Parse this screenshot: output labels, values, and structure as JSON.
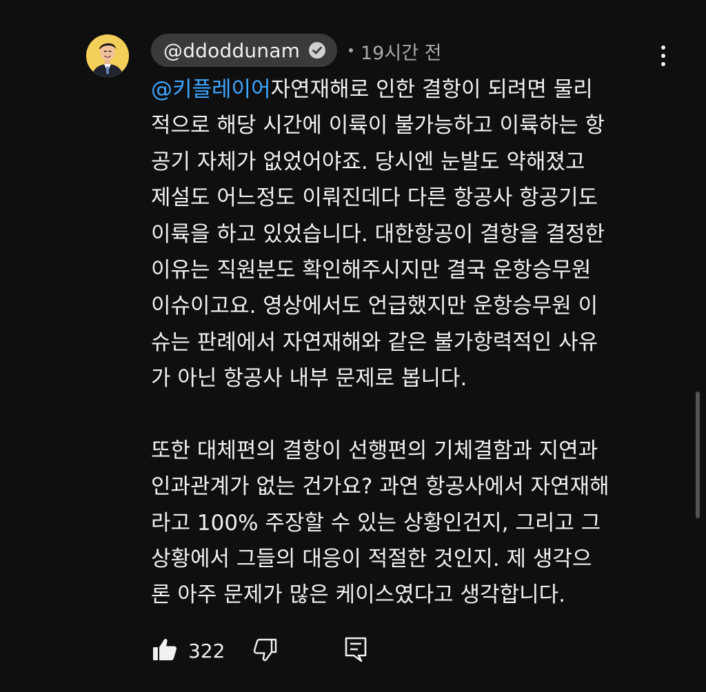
{
  "comment": {
    "author": "@ddoddunam",
    "time": "19시간 전",
    "mention": "@키플레이어",
    "first_line_rest": "자연재해로 인한 결항이 되려면 물리",
    "paragraph1_lines": [
      "적으로 해당 시간에 이륙이 불가능하고 이륙하는 항",
      "공기 자체가 없었어야죠. 당시엔 눈발도 약해졌고",
      "제설도 어느정도 이뤄진데다 다른 항공사 항공기도",
      "이륙을 하고 있었습니다. 대한항공이 결항을 결정한",
      "이유는 직원분도 확인해주시지만 결국 운항승무원",
      "이슈이고요. 영상에서도 언급했지만 운항승무원 이",
      "슈는 판례에서 자연재해와 같은 불가항력적인 사유",
      "가 아닌 항공사 내부 문제로 봅니다."
    ],
    "paragraph2_lines": [
      "또한 대체편의 결항이 선행편의 기체결함과 지연과",
      "인과관계가 없는 건가요? 과연 항공사에서 자연재해",
      "라고 100% 주장할 수 있는 상황인건지, 그리고 그",
      "상황에서 그들의 대응이 적절한 것인지. 제 생각으",
      "론 아주 문제가 많은 케이스였다고 생각합니다."
    ],
    "like_count": "322"
  },
  "icons": {
    "avatar": "avatar-portrait",
    "verified": "checkmark-circle-icon",
    "more": "more-vertical-icon",
    "like": "thumbs-up-icon",
    "dislike": "thumbs-down-icon",
    "reply": "reply-comment-icon"
  },
  "colors": {
    "background": "#0f0f0f",
    "text": "#f1f1f1",
    "secondary_text": "#aaaaaa",
    "mention": "#3ea6ff",
    "author_chip": "#3a3a3a",
    "avatar_bg": "#f3cf5a"
  }
}
